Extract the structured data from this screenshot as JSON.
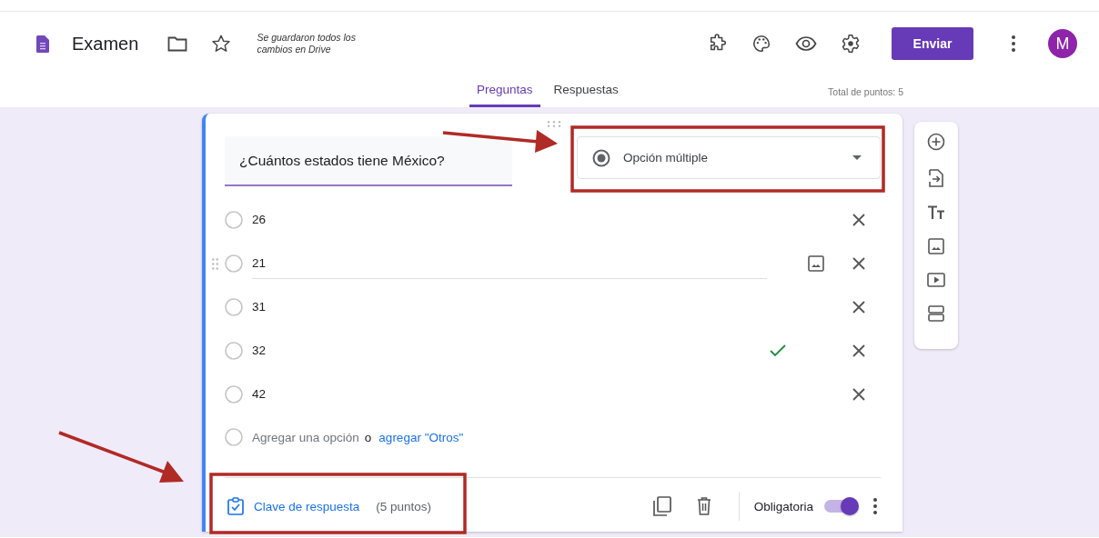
{
  "header": {
    "title": "Examen",
    "save_status": "Se guardaron todos los cambios en Drive",
    "send_button": "Enviar",
    "avatar": "M"
  },
  "tabs": [
    {
      "label": "Preguntas",
      "selected": true
    },
    {
      "label": "Respuestas",
      "selected": false
    }
  ],
  "total_points": "Total de puntos: 5",
  "question": {
    "title": "¿Cuántos estados tiene México?",
    "type": "Opción múltiple",
    "options": [
      {
        "label": "26",
        "correct": false,
        "focused": false
      },
      {
        "label": "21",
        "correct": false,
        "focused": true
      },
      {
        "label": "31",
        "correct": false,
        "focused": false
      },
      {
        "label": "32",
        "correct": true,
        "focused": false
      },
      {
        "label": "42",
        "correct": false,
        "focused": false
      }
    ],
    "add_option": "Agregar una opción",
    "or": "o",
    "add_other": "agregar \"Otros\"",
    "answer_key": "Clave de respuesta",
    "points": "(5 puntos)",
    "required_label": "Obligatoria",
    "required": true
  }
}
